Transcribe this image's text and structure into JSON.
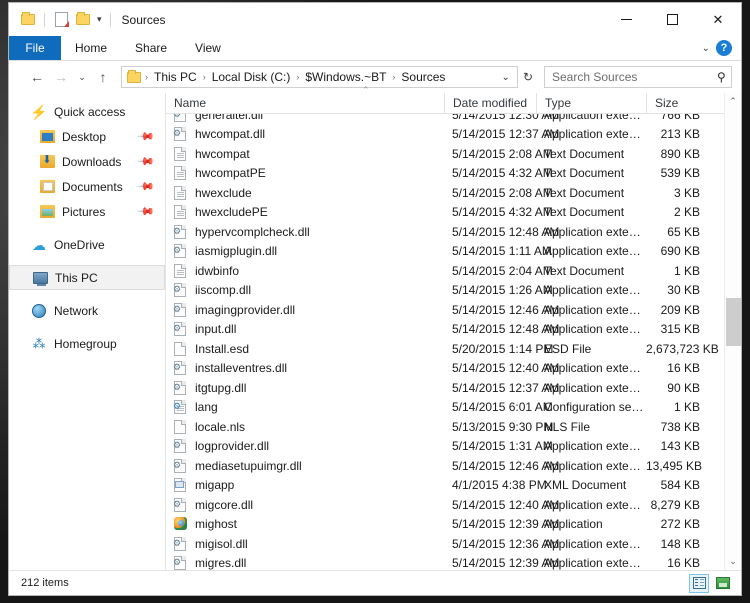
{
  "window": {
    "title": "Sources",
    "quick_access_icons": [
      "folder-icon",
      "properties-icon",
      "new-folder-icon",
      "customize-chevron-icon"
    ],
    "controls": {
      "minimize": "minimize-icon",
      "maximize": "maximize-icon",
      "close": "close-icon"
    }
  },
  "ribbon": {
    "tabs": [
      {
        "label": "File",
        "active": true
      },
      {
        "label": "Home",
        "active": false
      },
      {
        "label": "Share",
        "active": false
      },
      {
        "label": "View",
        "active": false
      }
    ],
    "expand_chevron": "⌄",
    "help_label": "?"
  },
  "addressbar": {
    "back": "←",
    "forward": "→",
    "recent": "⌄",
    "up": "↑",
    "breadcrumbs": [
      "This PC",
      "Local Disk (C:)",
      "$Windows.~BT",
      "Sources"
    ],
    "separator": "›",
    "dropdown": "⌄",
    "refresh": "↻"
  },
  "search": {
    "placeholder": "Search Sources",
    "icon": "search-icon"
  },
  "sidebar": {
    "items": [
      {
        "label": "Quick access",
        "icon": "quick-access-icon",
        "indent": false,
        "pinned": false,
        "selected": false
      },
      {
        "label": "Desktop",
        "icon": "desktop-folder-icon",
        "indent": true,
        "pinned": true,
        "selected": false
      },
      {
        "label": "Downloads",
        "icon": "downloads-folder-icon",
        "indent": true,
        "pinned": true,
        "selected": false
      },
      {
        "label": "Documents",
        "icon": "documents-folder-icon",
        "indent": true,
        "pinned": true,
        "selected": false
      },
      {
        "label": "Pictures",
        "icon": "pictures-folder-icon",
        "indent": true,
        "pinned": true,
        "selected": false
      },
      {
        "label": "OneDrive",
        "icon": "onedrive-cloud-icon",
        "indent": false,
        "pinned": false,
        "selected": false
      },
      {
        "label": "This PC",
        "icon": "this-pc-icon",
        "indent": false,
        "pinned": false,
        "selected": true
      },
      {
        "label": "Network",
        "icon": "network-icon",
        "indent": false,
        "pinned": false,
        "selected": false
      },
      {
        "label": "Homegroup",
        "icon": "homegroup-icon",
        "indent": false,
        "pinned": false,
        "selected": false
      }
    ],
    "pin_glyph": "📌"
  },
  "columns": [
    {
      "key": "name",
      "label": "Name",
      "sorted": true,
      "sort_glyph": "⌃"
    },
    {
      "key": "date",
      "label": "Date modified",
      "sorted": false
    },
    {
      "key": "type",
      "label": "Type",
      "sorted": false
    },
    {
      "key": "size",
      "label": "Size",
      "sorted": false
    }
  ],
  "files": [
    {
      "name": "generaltel.dll",
      "date": "5/14/2015 12:30 AM",
      "type": "Application extens...",
      "size": "766 KB",
      "icon": "dll-icon",
      "clipped": true
    },
    {
      "name": "hwcompat.dll",
      "date": "5/14/2015 12:37 AM",
      "type": "Application extens...",
      "size": "213 KB",
      "icon": "dll-icon"
    },
    {
      "name": "hwcompat",
      "date": "5/14/2015 2:08 AM",
      "type": "Text Document",
      "size": "890 KB",
      "icon": "text-document-icon"
    },
    {
      "name": "hwcompatPE",
      "date": "5/14/2015 4:32 AM",
      "type": "Text Document",
      "size": "539 KB",
      "icon": "text-document-icon"
    },
    {
      "name": "hwexclude",
      "date": "5/14/2015 2:08 AM",
      "type": "Text Document",
      "size": "3 KB",
      "icon": "text-document-icon"
    },
    {
      "name": "hwexcludePE",
      "date": "5/14/2015 4:32 AM",
      "type": "Text Document",
      "size": "2 KB",
      "icon": "text-document-icon"
    },
    {
      "name": "hypervcomplcheck.dll",
      "date": "5/14/2015 12:48 AM",
      "type": "Application extens...",
      "size": "65 KB",
      "icon": "dll-icon"
    },
    {
      "name": "iasmigplugin.dll",
      "date": "5/14/2015 1:11 AM",
      "type": "Application extens...",
      "size": "690 KB",
      "icon": "dll-icon"
    },
    {
      "name": "idwbinfo",
      "date": "5/14/2015 2:04 AM",
      "type": "Text Document",
      "size": "1 KB",
      "icon": "text-document-icon"
    },
    {
      "name": "iiscomp.dll",
      "date": "5/14/2015 1:26 AM",
      "type": "Application extens...",
      "size": "30 KB",
      "icon": "dll-icon"
    },
    {
      "name": "imagingprovider.dll",
      "date": "5/14/2015 12:46 AM",
      "type": "Application extens...",
      "size": "209 KB",
      "icon": "dll-icon"
    },
    {
      "name": "input.dll",
      "date": "5/14/2015 12:48 AM",
      "type": "Application extens...",
      "size": "315 KB",
      "icon": "dll-icon"
    },
    {
      "name": "Install.esd",
      "date": "5/20/2015 1:14 PM",
      "type": "ESD File",
      "size": "2,673,723 KB",
      "icon": "blank-file-icon"
    },
    {
      "name": "installeventres.dll",
      "date": "5/14/2015 12:40 AM",
      "type": "Application extens...",
      "size": "16 KB",
      "icon": "dll-icon"
    },
    {
      "name": "itgtupg.dll",
      "date": "5/14/2015 12:37 AM",
      "type": "Application extens...",
      "size": "90 KB",
      "icon": "dll-icon"
    },
    {
      "name": "lang",
      "date": "5/14/2015 6:01 AM",
      "type": "Configuration sett...",
      "size": "1 KB",
      "icon": "config-settings-icon"
    },
    {
      "name": "locale.nls",
      "date": "5/13/2015 9:30 PM",
      "type": "NLS File",
      "size": "738 KB",
      "icon": "blank-file-icon"
    },
    {
      "name": "logprovider.dll",
      "date": "5/14/2015 1:31 AM",
      "type": "Application extens...",
      "size": "143 KB",
      "icon": "dll-icon"
    },
    {
      "name": "mediasetupuimgr.dll",
      "date": "5/14/2015 12:46 AM",
      "type": "Application extens...",
      "size": "13,495 KB",
      "icon": "dll-icon"
    },
    {
      "name": "migapp",
      "date": "4/1/2015 4:38 PM",
      "type": "XML Document",
      "size": "584 KB",
      "icon": "xml-document-icon"
    },
    {
      "name": "migcore.dll",
      "date": "5/14/2015 12:40 AM",
      "type": "Application extens...",
      "size": "8,279 KB",
      "icon": "dll-icon"
    },
    {
      "name": "mighost",
      "date": "5/14/2015 12:39 AM",
      "type": "Application",
      "size": "272 KB",
      "icon": "application-icon"
    },
    {
      "name": "migisol.dll",
      "date": "5/14/2015 12:36 AM",
      "type": "Application extens...",
      "size": "148 KB",
      "icon": "dll-icon"
    },
    {
      "name": "migres.dll",
      "date": "5/14/2015 12:39 AM",
      "type": "Application extens...",
      "size": "16 KB",
      "icon": "dll-icon"
    }
  ],
  "scrollbar": {
    "up_arrow": "⌃",
    "down_arrow": "⌄"
  },
  "statusbar": {
    "item_count": "212 items",
    "views": [
      {
        "name": "details-view-button",
        "active": true
      },
      {
        "name": "large-icons-view-button",
        "active": false
      }
    ]
  }
}
